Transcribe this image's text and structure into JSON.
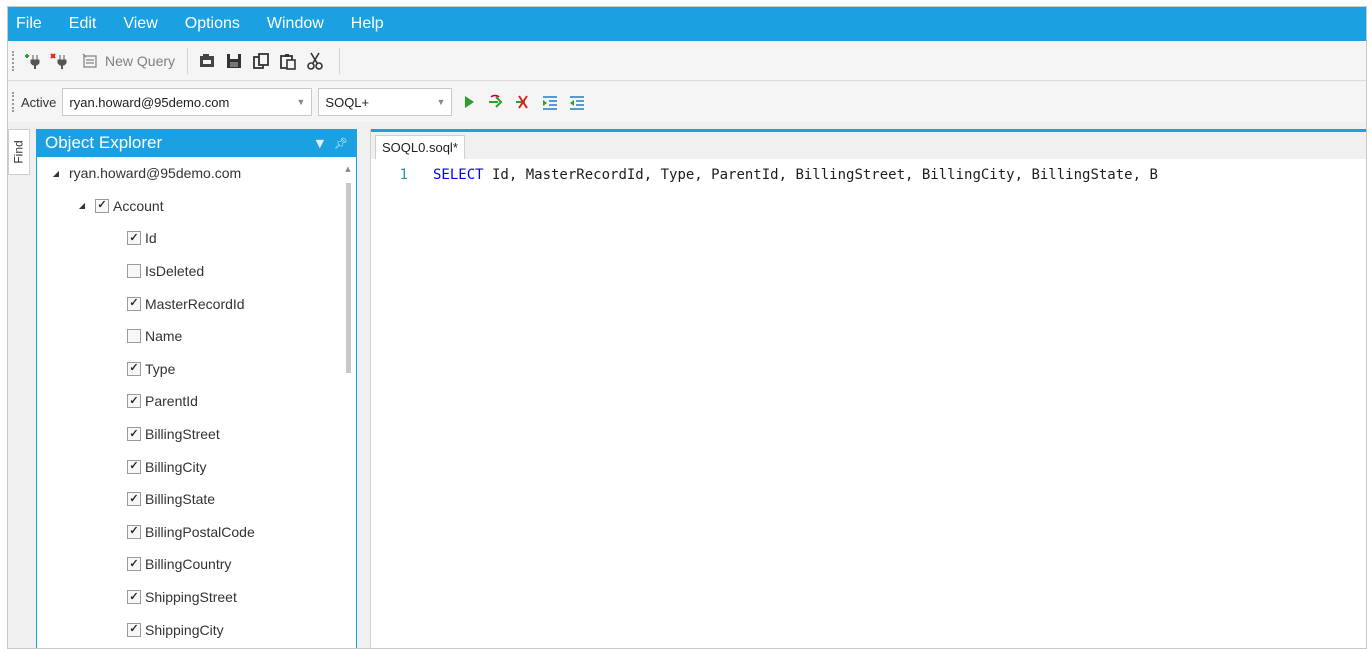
{
  "menu": [
    "File",
    "Edit",
    "View",
    "Options",
    "Window",
    "Help"
  ],
  "toolbar": {
    "new_query_label": "New Query",
    "icons": [
      "add-connection-icon",
      "remove-connection-icon",
      "new-query-icon",
      "open-icon",
      "save-icon",
      "copy-icon",
      "paste-icon",
      "cut-icon"
    ]
  },
  "connection": {
    "active_label": "Active",
    "user": "ryan.howard@95demo.com",
    "language": "SOQL+"
  },
  "find_tab": "Find",
  "explorer": {
    "title": "Object Explorer",
    "root": "ryan.howard@95demo.com",
    "object": {
      "name": "Account",
      "checked": true
    },
    "fields": [
      {
        "name": "Id",
        "checked": true
      },
      {
        "name": "IsDeleted",
        "checked": false
      },
      {
        "name": "MasterRecordId",
        "checked": true
      },
      {
        "name": "Name",
        "checked": false
      },
      {
        "name": "Type",
        "checked": true
      },
      {
        "name": "ParentId",
        "checked": true
      },
      {
        "name": "BillingStreet",
        "checked": true
      },
      {
        "name": "BillingCity",
        "checked": true
      },
      {
        "name": "BillingState",
        "checked": true
      },
      {
        "name": "BillingPostalCode",
        "checked": true
      },
      {
        "name": "BillingCountry",
        "checked": true
      },
      {
        "name": "ShippingStreet",
        "checked": true
      },
      {
        "name": "ShippingCity",
        "checked": true
      }
    ]
  },
  "editor": {
    "tab_label": "SOQL0.soql*",
    "line_number": "1",
    "keyword": "SELECT",
    "code": " Id, MasterRecordId, Type, ParentId, BillingStreet, BillingCity, BillingState, B"
  },
  "colors": {
    "accent": "#1ba1e2",
    "keyword": "#0000ff",
    "line_number": "#2b91af",
    "run": "#2e9e2e"
  }
}
